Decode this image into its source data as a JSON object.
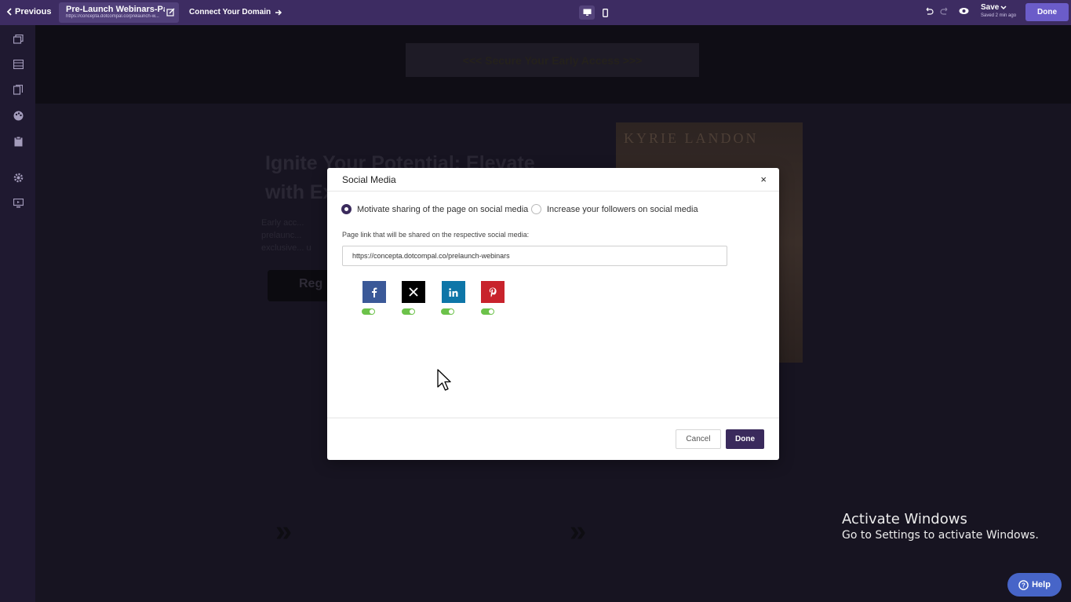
{
  "topbar": {
    "previous_label": "Previous",
    "page_tab_title": "Pre-Launch Webinars-Pag...",
    "page_tab_url": "https://concepta.dotcompal.co/prelaunch-w...",
    "connect_domain_label": "Connect Your Domain",
    "save_label": "Save",
    "save_status": "Saved 2 min ago",
    "done_label": "Done",
    "accent_color": "#3d2c62",
    "done_color": "#6b5cc9"
  },
  "sidebar": {
    "icons": [
      "pages-icon",
      "sections-icon",
      "templates-icon",
      "theme-icon",
      "clipboard-icon",
      "settings-icon",
      "preview-icon"
    ]
  },
  "background_page": {
    "cta_strip_text": "<<< Secure Your Early Access >>>",
    "headline": "Ignite Your Potential: Elevate with Ex",
    "paragraph_fragment": "Early acc... prelaunc... exclusive... u",
    "button_fragment": "Reg",
    "image_text": "KYRIE LANDON",
    "chevron_glyph": "»"
  },
  "modal": {
    "title": "Social Media",
    "close_glyph": "×",
    "option_share": "Motivate sharing of the page on social media",
    "option_followers": "Increase your followers on social media",
    "selected_option": "share",
    "link_label": "Page link that will be shared on the respective social media:",
    "link_value": "https://concepta.dotcompal.co/prelaunch-webinars",
    "networks": [
      {
        "name": "facebook",
        "glyph": "f",
        "color": "#3b5998",
        "enabled": true
      },
      {
        "name": "x",
        "glyph": "X",
        "color": "#000000",
        "enabled": true
      },
      {
        "name": "linkedin",
        "glyph": "in",
        "color": "#0e76a8",
        "enabled": true
      },
      {
        "name": "pinterest",
        "glyph": "P",
        "color": "#c8232c",
        "enabled": true
      }
    ],
    "cancel_label": "Cancel",
    "done_label": "Done"
  },
  "watermark": {
    "title": "Activate Windows",
    "subtitle": "Go to Settings to activate Windows."
  },
  "help_label": "Help"
}
